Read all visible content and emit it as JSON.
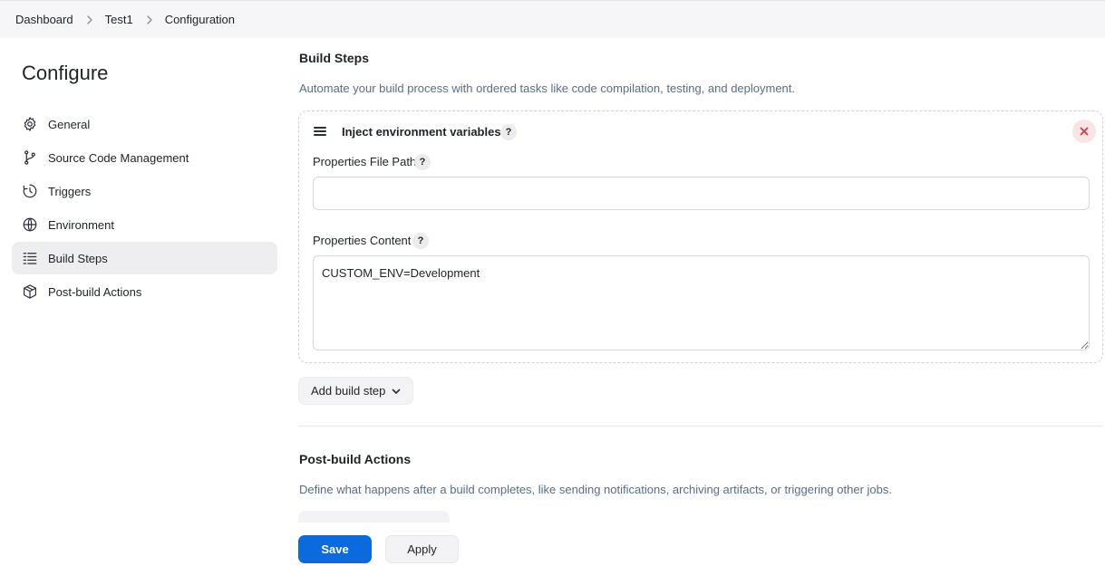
{
  "breadcrumb": {
    "items": [
      "Dashboard",
      "Test1",
      "Configuration"
    ]
  },
  "sidebar": {
    "title": "Configure",
    "items": [
      {
        "label": "General",
        "icon": "gear-icon"
      },
      {
        "label": "Source Code Management",
        "icon": "branch-icon"
      },
      {
        "label": "Triggers",
        "icon": "clock-icon"
      },
      {
        "label": "Environment",
        "icon": "globe-icon"
      },
      {
        "label": "Build Steps",
        "icon": "list-icon",
        "active": true
      },
      {
        "label": "Post-build Actions",
        "icon": "package-icon"
      }
    ]
  },
  "build_steps": {
    "title": "Build Steps",
    "description": "Automate your build process with ordered tasks like code compilation, testing, and deployment.",
    "step": {
      "title": "Inject environment variables",
      "help": "?",
      "file_path_label": "Properties File Path",
      "file_path_value": "",
      "content_label": "Properties Content",
      "content_value": "CUSTOM_ENV=Development"
    },
    "add_label": "Add build step"
  },
  "post_build": {
    "title": "Post-build Actions",
    "description": "Define what happens after a build completes, like sending notifications, archiving artifacts, or triggering other jobs."
  },
  "actions": {
    "save_label": "Save",
    "apply_label": "Apply"
  },
  "colors": {
    "accent": "#0b6bde",
    "description_text": "#5a6d8a",
    "close_red": "#d33a4a"
  }
}
